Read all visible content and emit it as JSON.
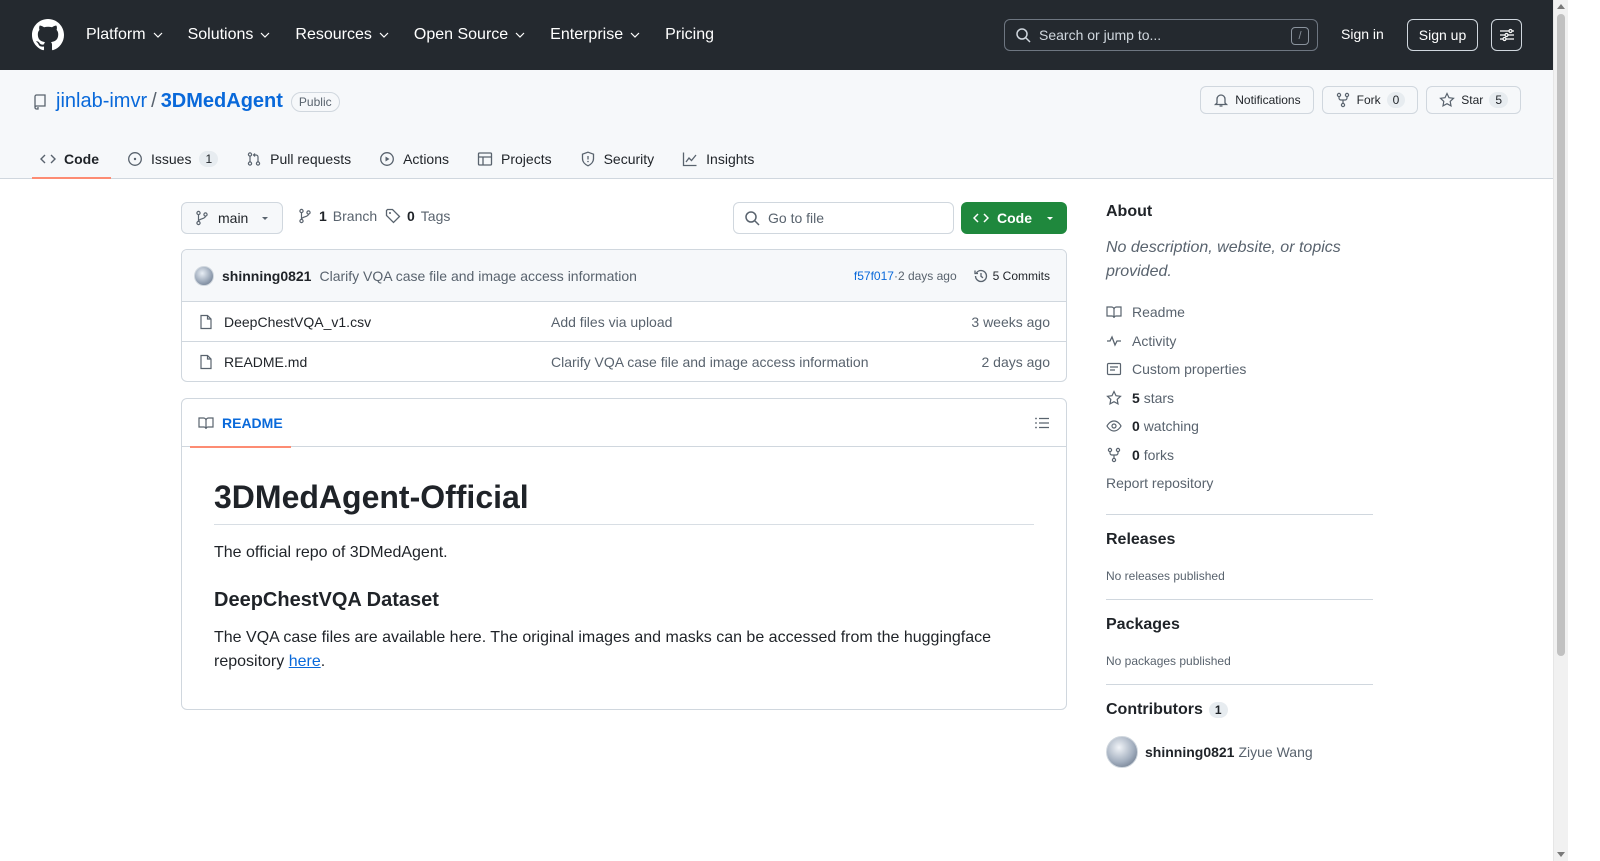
{
  "header": {
    "nav": [
      {
        "label": "Platform",
        "has_menu": true
      },
      {
        "label": "Solutions",
        "has_menu": true
      },
      {
        "label": "Resources",
        "has_menu": true
      },
      {
        "label": "Open Source",
        "has_menu": true
      },
      {
        "label": "Enterprise",
        "has_menu": true
      },
      {
        "label": "Pricing",
        "has_menu": false
      }
    ],
    "search_placeholder": "Search or jump to...",
    "search_shortcut": "/",
    "sign_in": "Sign in",
    "sign_up": "Sign up"
  },
  "repo": {
    "owner": "jinlab-imvr",
    "separator": "/",
    "name": "3DMedAgent",
    "visibility": "Public",
    "notifications_label": "Notifications",
    "fork_label": "Fork",
    "fork_count": "0",
    "star_label": "Star",
    "star_count": "5",
    "tabs": [
      {
        "label": "Code",
        "icon": "code-icon",
        "active": true
      },
      {
        "label": "Issues",
        "icon": "issue-icon",
        "count": "1"
      },
      {
        "label": "Pull requests",
        "icon": "pull-request-icon"
      },
      {
        "label": "Actions",
        "icon": "play-icon"
      },
      {
        "label": "Projects",
        "icon": "table-icon"
      },
      {
        "label": "Security",
        "icon": "shield-icon"
      },
      {
        "label": "Insights",
        "icon": "graph-icon"
      }
    ]
  },
  "toolbar": {
    "branch": "main",
    "branch_count": "1",
    "branch_label": "Branch",
    "tag_count": "0",
    "tag_label": "Tags",
    "goto_placeholder": "Go to file",
    "code_button": "Code"
  },
  "latest_commit": {
    "author": "shinning0821",
    "message": "Clarify VQA case file and image access information",
    "sha": "f57f017",
    "dot": " · ",
    "time": "2 days ago",
    "commits_label": "5 Commits"
  },
  "files": [
    {
      "name": "DeepChestVQA_v1.csv",
      "commit": "Add files via upload",
      "date": "3 weeks ago"
    },
    {
      "name": "README.md",
      "commit": "Clarify VQA case file and image access information",
      "date": "2 days ago"
    }
  ],
  "readme": {
    "tab_label": "README",
    "title": "3DMedAgent-Official",
    "intro": "The official repo of 3DMedAgent.",
    "section_title": "DeepChestVQA Dataset",
    "section_text": "The VQA case files are available here. The original images and masks can be accessed from the huggingface repository ",
    "link_text": "here",
    "trailing": "."
  },
  "sidebar": {
    "about_title": "About",
    "about_desc": "No description, website, or topics provided.",
    "readme": "Readme",
    "activity": "Activity",
    "custom_properties": "Custom properties",
    "stars_count": "5",
    "stars_label": "stars",
    "watching_count": "0",
    "watching_label": "watching",
    "forks_count": "0",
    "forks_label": "forks",
    "report": "Report repository",
    "releases_title": "Releases",
    "releases_text": "No releases published",
    "packages_title": "Packages",
    "packages_text": "No packages published",
    "contributors_title": "Contributors",
    "contributors_count": "1",
    "contributor_login": "shinning0821",
    "contributor_name": "Ziyue Wang"
  },
  "colors": {
    "header_bg": "#24292f",
    "link": "#0969da",
    "primary_button": "#1f883d",
    "active_tab_underline": "#fd8c73"
  }
}
